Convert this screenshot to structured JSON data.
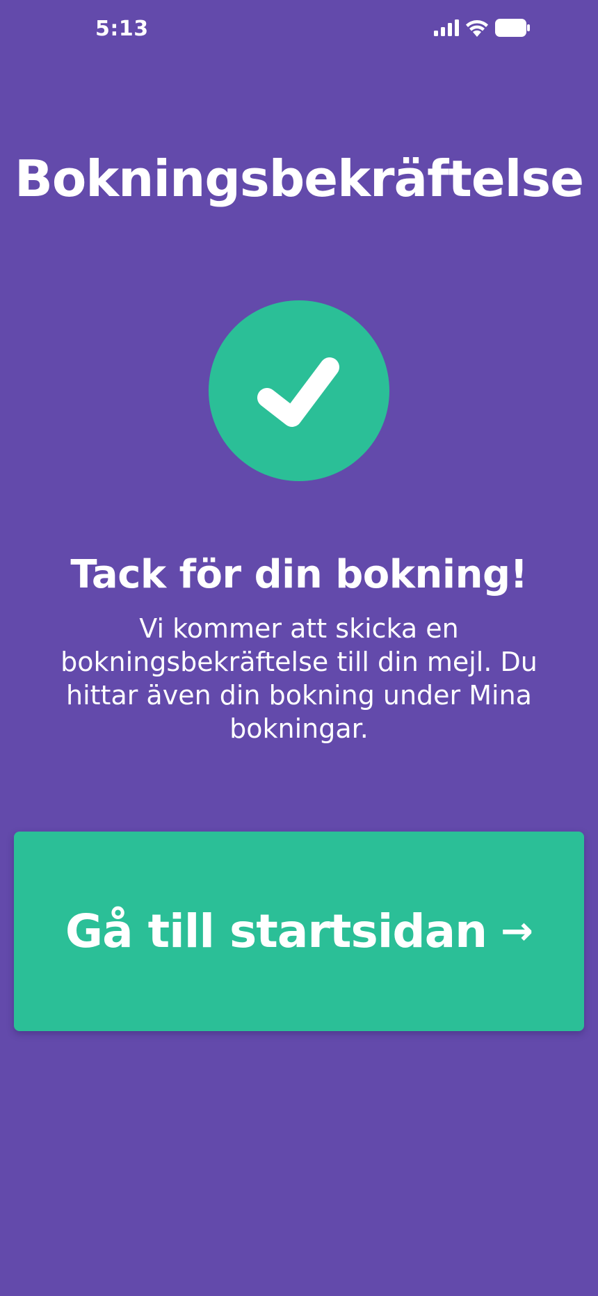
{
  "status_bar": {
    "time": "5:13",
    "icons": [
      "signal-icon",
      "wifi-icon",
      "battery-icon"
    ]
  },
  "page": {
    "title": "Bokningsbekräftelse"
  },
  "confirmation": {
    "icon": "checkmark-icon",
    "heading": "Tack för din bokning!",
    "message": "Vi kommer att skicka en bokningsbekräftelse till din mejl. Du hittar även din bokning under Mina bokningar."
  },
  "actions": {
    "home_button_label": "Gå till startsidan",
    "home_button_arrow": "→"
  },
  "colors": {
    "background": "#634aab",
    "accent": "#2bbf97",
    "text": "#ffffff"
  }
}
